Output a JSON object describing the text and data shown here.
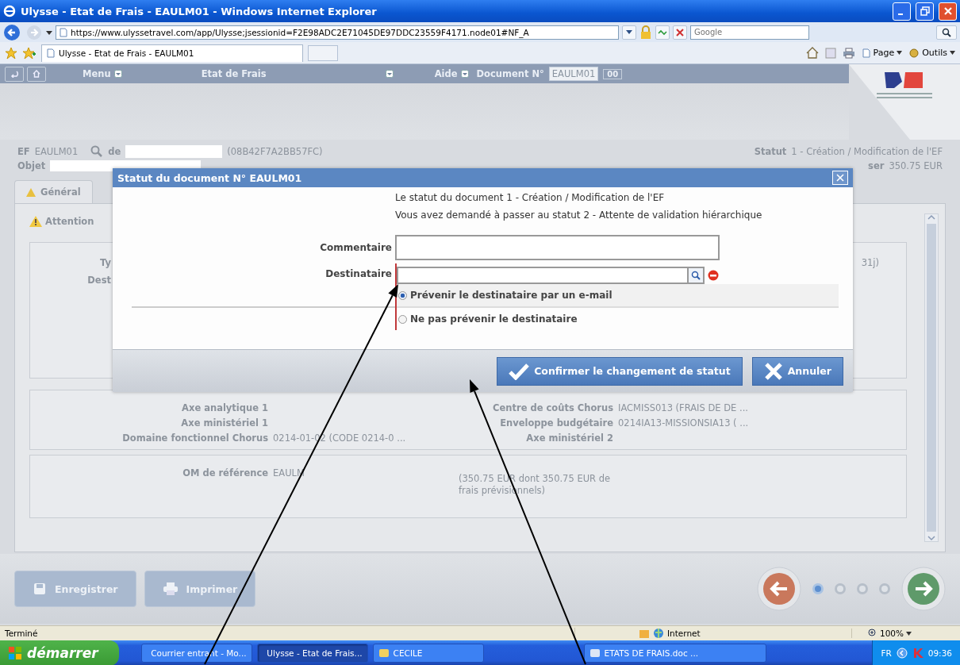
{
  "window": {
    "title": "Ulysse - Etat de Frais - EAULM01 - Windows Internet Explorer"
  },
  "address_bar": {
    "url": "https://www.ulyssetravel.com/app/Ulysse;jsessionid=F2E98ADC2E71045DE97DDC23559F4171.node01#NF_A",
    "search_placeholder": "Google"
  },
  "browser_tab": {
    "title": "Ulysse - Etat de Frais - EAULM01"
  },
  "command_bar": [
    "Page",
    "Outils"
  ],
  "app_header": {
    "menus": [
      {
        "label": "Menu"
      },
      {
        "label": "Etat de Frais"
      },
      {
        "label": "Aide"
      }
    ],
    "document_label": "Document N°",
    "document_value": "EAULM01",
    "go_label": "00"
  },
  "summary": {
    "ef_label": "EF",
    "ef_value": "EAULM01",
    "de_label": "de",
    "traveler_code": "(08B42F7A2BB57FC)",
    "objet_label": "Objet",
    "statut_label": "Statut",
    "statut_value": "1 - Création / Modification de l'EF",
    "amount_label_fragment": "ser",
    "amount": "350.75 EUR"
  },
  "tabs": [
    {
      "label": "Général",
      "selected": true
    }
  ],
  "panel": {
    "attention": "Attention",
    "field_fragments": [
      "Ty",
      "Dest"
    ],
    "duration_fragment": "31j)"
  },
  "analytics": {
    "left": [
      {
        "label": "Axe analytique 1"
      },
      {
        "label": "Axe ministériel 1"
      },
      {
        "label": "Domaine fonctionnel Chorus",
        "value": "0214-01-02 (CODE 0214-0 ..."
      }
    ],
    "right": [
      {
        "label": "Centre de coûts Chorus",
        "value": "IACMISS013 (FRAIS DE DE ..."
      },
      {
        "label": "Enveloppe budgétaire",
        "value": "0214IA13-MISSIONSIA13 ( ..."
      },
      {
        "label": "Axe ministériel 2"
      }
    ]
  },
  "reference": {
    "label": "OM de référence",
    "value": "EAULM",
    "note": "(350.75 EUR dont 350.75 EUR de frais prévisionnels)"
  },
  "footer": {
    "buttons": [
      "Enregistrer",
      "Imprimer"
    ],
    "steps": [
      {
        "selected": true
      },
      {
        "selected": false
      },
      {
        "selected": false
      },
      {
        "selected": false
      }
    ]
  },
  "dialog": {
    "title": "Statut du document N° EAULM01",
    "current_status": "Le statut du document 1 - Création / Modification de l'EF",
    "requested_status": "Vous avez demandé à passer au statut 2 - Attente de validation hiérarchique",
    "comment_label": "Commentaire",
    "recipient_label": "Destinataire",
    "notify_options": [
      {
        "label": "Prévenir le destinataire par un e-mail",
        "selected": true
      },
      {
        "label": "Ne pas prévenir le destinataire",
        "selected": false
      }
    ],
    "buttons": [
      {
        "label": "Confirmer le changement de statut",
        "kind": "confirm"
      },
      {
        "label": "Annuler",
        "kind": "cancel"
      }
    ]
  },
  "status_bar": {
    "text": "Terminé",
    "zone": "Internet",
    "zoom": "100%"
  },
  "taskbar": {
    "start": "démarrer",
    "items": [
      {
        "label": "Courrier entrant - Mo...",
        "selected": false
      },
      {
        "label": "Ulysse - Etat de Frais...",
        "selected": true
      },
      {
        "label": "CECILE",
        "selected": false
      },
      {
        "label": "ETATS DE FRAIS.doc ...",
        "selected": false
      }
    ],
    "language": "FR",
    "time": "09:36"
  }
}
